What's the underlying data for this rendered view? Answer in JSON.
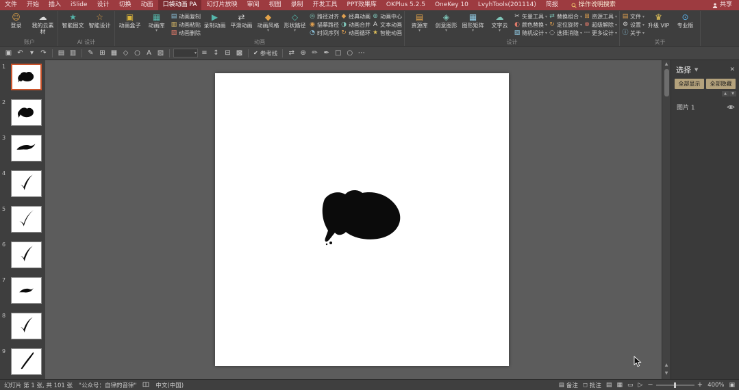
{
  "menubar": {
    "tabs": [
      {
        "label": "文件"
      },
      {
        "label": "开始"
      },
      {
        "label": "插入"
      },
      {
        "label": "iSlide"
      },
      {
        "label": "设计"
      },
      {
        "label": "切换"
      },
      {
        "label": "动画"
      },
      {
        "label": "口袋动画 PA",
        "active": true
      },
      {
        "label": "幻灯片放映"
      },
      {
        "label": "审阅"
      },
      {
        "label": "视图"
      },
      {
        "label": "录制"
      },
      {
        "label": "开发工具"
      },
      {
        "label": "PPT效果库"
      },
      {
        "label": "OKPlus 5.2.5"
      },
      {
        "label": "OneKey 10"
      },
      {
        "label": "LvyhTools(201114)"
      },
      {
        "label": "简报"
      }
    ],
    "search_label": "操作说明搜索",
    "share_label": "共享"
  },
  "ribbon": {
    "groups": [
      {
        "label": "账户",
        "columns": [
          {
            "type": "big",
            "items": [
              {
                "label": "登录",
                "icon": "user",
                "glyph": "☺",
                "color": "#e2a24a"
              },
              {
                "label": "我的云素材",
                "icon": "cloud",
                "glyph": "☁",
                "color": "#d9d9d9"
              }
            ]
          }
        ]
      },
      {
        "label": "AI 设计",
        "columns": [
          {
            "type": "big",
            "items": [
              {
                "label": "智能图文",
                "icon": "smart-text",
                "glyph": "★",
                "color": "#55b7ac"
              },
              {
                "label": "智能设计",
                "icon": "smart-design",
                "glyph": "☆",
                "color": "#e2a24a"
              }
            ]
          }
        ]
      },
      {
        "label": "动画",
        "columns": [
          {
            "type": "big",
            "items": [
              {
                "label": "动画盒子",
                "icon": "animation-box",
                "glyph": "▣",
                "color": "#d9b43c"
              },
              {
                "label": "动画库",
                "icon": "animation-library",
                "glyph": "▦",
                "color": "#55b7ac",
                "arrow": true
              }
            ]
          },
          {
            "type": "stack",
            "items": [
              {
                "label": "动画复制",
                "icon": "animation-copy",
                "glyph": "▤",
                "color": "#8fc7e0"
              },
              {
                "label": "动画粘贴",
                "icon": "animation-paste",
                "glyph": "▥",
                "color": "#e0c06a"
              },
              {
                "label": "动画删除",
                "icon": "animation-delete",
                "glyph": "▧",
                "color": "#e07a6a"
              }
            ]
          },
          {
            "type": "big",
            "items": [
              {
                "label": "录制动画",
                "icon": "record-animation",
                "glyph": "▶",
                "color": "#55b7ac"
              },
              {
                "label": "平滑动画",
                "icon": "smooth-animation",
                "glyph": "⇄",
                "color": "#cfcfcf"
              }
            ]
          },
          {
            "type": "big",
            "items": [
              {
                "label": "动画风格",
                "icon": "animation-style",
                "glyph": "◆",
                "color": "#e2a24a",
                "arrow": true
              },
              {
                "label": "形状路径",
                "icon": "shape-path",
                "glyph": "◇",
                "color": "#55b7ac",
                "arrow": true
              }
            ]
          },
          {
            "type": "stack",
            "items": [
              {
                "label": "路径对齐",
                "icon": "path-align",
                "glyph": "◎",
                "color": "#7ec4b8"
              },
              {
                "label": "描摹路径",
                "icon": "trace-path",
                "glyph": "◉",
                "color": "#e0a050"
              },
              {
                "label": "时间序列",
                "icon": "time-sequence",
                "glyph": "◔",
                "color": "#8fc7e0"
              }
            ]
          },
          {
            "type": "stack",
            "items": [
              {
                "label": "经典动画",
                "icon": "classic-animation",
                "glyph": "◆",
                "color": "#e0a050"
              },
              {
                "label": "动画合并",
                "icon": "animation-merge",
                "glyph": "◑",
                "color": "#7ec4b8"
              },
              {
                "label": "动画循环",
                "icon": "animation-loop",
                "glyph": "↻",
                "color": "#e0a050"
              }
            ]
          },
          {
            "type": "stack",
            "items": [
              {
                "label": "动画中心",
                "icon": "animation-center",
                "glyph": "⊕",
                "color": "#7ec4b8"
              },
              {
                "label": "文本动画",
                "icon": "text-animation",
                "glyph": "A",
                "color": "#d9d9d9"
              },
              {
                "label": "智能动画",
                "icon": "smart-animation",
                "glyph": "★",
                "color": "#e0c05a"
              }
            ]
          }
        ]
      },
      {
        "label": "设计",
        "columns": [
          {
            "type": "big",
            "items": [
              {
                "label": "资源库",
                "icon": "resource-library",
                "glyph": "▤",
                "color": "#e2a24a",
                "arrow": true
              },
              {
                "label": "创意图形",
                "icon": "creative-shapes",
                "glyph": "◈",
                "color": "#7ec4b8",
                "arrow": true
              },
              {
                "label": "图形矩阵",
                "icon": "shape-matrix",
                "glyph": "▦",
                "color": "#8fc7e0",
                "arrow": true
              },
              {
                "label": "文字云",
                "icon": "word-cloud",
                "glyph": "☁",
                "color": "#7ec4b8",
                "arrow": true
              }
            ]
          },
          {
            "type": "stack",
            "items": [
              {
                "label": "矢量工具",
                "icon": "vector-tools",
                "glyph": "✂",
                "color": "#d9d9d9",
                "arrow": true
              },
              {
                "label": "颜色替换",
                "icon": "color-replace",
                "glyph": "◐",
                "color": "#e07a6a",
                "arrow": true
              },
              {
                "label": "随机设计",
                "icon": "random-design",
                "glyph": "▨",
                "color": "#8fc7e0",
                "arrow": true
              }
            ]
          },
          {
            "type": "stack",
            "items": [
              {
                "label": "替换组合",
                "icon": "replace-group",
                "glyph": "⇄",
                "color": "#7ec4b8",
                "arrow": true
              },
              {
                "label": "定位旋转",
                "icon": "position-rotate",
                "glyph": "↻",
                "color": "#e0a050",
                "arrow": true
              },
              {
                "label": "选择消隐",
                "icon": "select-hide",
                "glyph": "◌",
                "color": "#d9d9d9",
                "arrow": true
              }
            ]
          },
          {
            "type": "stack",
            "items": [
              {
                "label": "资源工具",
                "icon": "resource-tools",
                "glyph": "⊞",
                "color": "#e0a050",
                "arrow": true
              },
              {
                "label": "超级解除",
                "icon": "super-ungroup",
                "glyph": "⊗",
                "color": "#e07a6a",
                "arrow": true
              },
              {
                "label": "更多设计",
                "icon": "more-design",
                "glyph": "⋯",
                "color": "#d9d9d9",
                "arrow": true
              }
            ]
          }
        ]
      },
      {
        "label": "关于",
        "columns": [
          {
            "type": "stack",
            "items": [
              {
                "label": "文件",
                "icon": "file",
                "glyph": "▤",
                "color": "#e0a050",
                "arrow": true
              },
              {
                "label": "设置",
                "icon": "settings-gear",
                "glyph": "⚙",
                "color": "#d9d9d9",
                "arrow": true
              },
              {
                "label": "关于",
                "icon": "about-info",
                "glyph": "ⓘ",
                "color": "#8fc7e0",
                "arrow": true
              }
            ]
          },
          {
            "type": "big",
            "items": [
              {
                "label": "升级 VIP",
                "icon": "upgrade-vip",
                "glyph": "♛",
                "color": "#e0c05a"
              },
              {
                "label": "专业版",
                "icon": "pro-version-toggle",
                "glyph": "⊙",
                "color": "#5ab0e8"
              }
            ]
          }
        ]
      }
    ]
  },
  "quickbar": {
    "items": [
      {
        "glyph": "▣",
        "name": "pane-layout-icon"
      },
      {
        "glyph": "↶",
        "name": "undo-icon"
      },
      {
        "glyph": "▾",
        "name": "undo-dropdown-icon"
      },
      {
        "glyph": "↷",
        "name": "redo-icon"
      },
      {
        "type": "sep"
      },
      {
        "glyph": "▤",
        "name": "thumbnail-pane-icon"
      },
      {
        "glyph": "▥",
        "name": "layout-icon"
      },
      {
        "type": "sep"
      },
      {
        "glyph": "✎",
        "name": "draw-icon"
      },
      {
        "glyph": "⊞",
        "name": "table-icon"
      },
      {
        "glyph": "▦",
        "name": "grid-icon"
      },
      {
        "glyph": "◇",
        "name": "shape-icon"
      },
      {
        "glyph": "○",
        "name": "ellipse-icon"
      },
      {
        "glyph": "A",
        "name": "font-color-icon"
      },
      {
        "glyph": "▨",
        "name": "fill-color-icon"
      },
      {
        "type": "sep"
      },
      {
        "type": "combo",
        "name": "style-combobox"
      },
      {
        "glyph": "≡",
        "name": "bullets-icon"
      },
      {
        "glyph": "↕",
        "name": "line-spacing-icon"
      },
      {
        "glyph": "⊟",
        "name": "merge-cells-icon"
      },
      {
        "glyph": "▩",
        "name": "pattern-icon"
      },
      {
        "type": "sep"
      },
      {
        "type": "check",
        "glyph": "✔",
        "label": "参考线",
        "name": "guides-checkbox"
      },
      {
        "type": "sep"
      },
      {
        "glyph": "⇄",
        "name": "swap-icon"
      },
      {
        "glyph": "⊕",
        "name": "insert-shape-icon"
      },
      {
        "glyph": "✏",
        "name": "pencil-icon"
      },
      {
        "glyph": "✒",
        "name": "pen-icon"
      },
      {
        "glyph": "□",
        "name": "rectangle-icon"
      },
      {
        "glyph": "○",
        "name": "circle-icon"
      },
      {
        "glyph": "⋯",
        "name": "more-tools-icon"
      }
    ]
  },
  "slides": {
    "items": [
      {
        "num": "1",
        "stroke": "blob",
        "selected": true
      },
      {
        "num": "2",
        "stroke": "blob2"
      },
      {
        "num": "3",
        "stroke": "comma"
      },
      {
        "num": "4",
        "stroke": "check"
      },
      {
        "num": "5",
        "stroke": "check2"
      },
      {
        "num": "6",
        "stroke": "check"
      },
      {
        "num": "7",
        "stroke": "comma_small"
      },
      {
        "num": "8",
        "stroke": "check"
      },
      {
        "num": "9",
        "stroke": "flick"
      }
    ]
  },
  "selection_pane": {
    "title": "选择",
    "show_all": "全部显示",
    "hide_all": "全部隐藏",
    "items": [
      {
        "label": "图片 1"
      }
    ]
  },
  "statusbar": {
    "slide_indicator": "幻灯片 第 1 张, 共 101 张",
    "note": "\"公众号：自律的音律\"",
    "language": "中文(中国)",
    "notes_label": "备注",
    "comments_label": "批注",
    "zoom_level": "400%"
  }
}
